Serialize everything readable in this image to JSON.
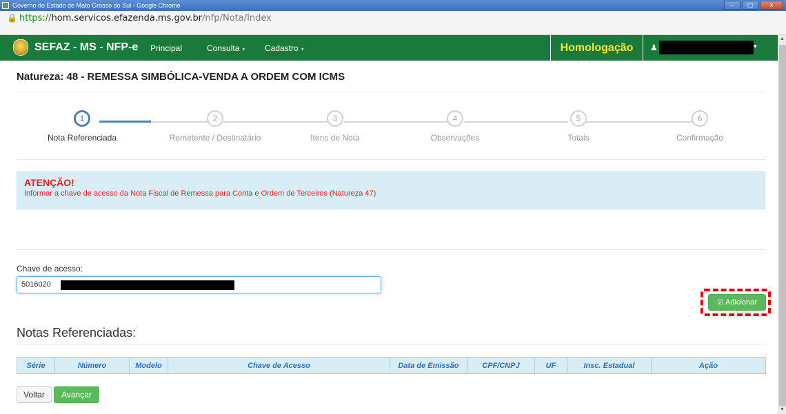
{
  "window": {
    "title": "Governo do Estado de Mato Grosso do Sul - Google Chrome",
    "controls": [
      "–",
      "▢",
      "x"
    ]
  },
  "address": {
    "scheme": "https://",
    "host": "hom.servicos.efazenda.ms.gov.br",
    "path": "/nfp/Nota/Index"
  },
  "navbar": {
    "brand": "SEFAZ - MS - NFP-e",
    "items": [
      "Principal",
      "Consulta",
      "Cadastro"
    ],
    "environment": "Homologação",
    "colors": {
      "background": "#1a7a3c",
      "environment_text": "#ffe833"
    }
  },
  "page": {
    "title": "Natureza: 48 - REMESSA SIMBÓLICA-VENDA A ORDEM COM ICMS"
  },
  "wizard": {
    "steps": [
      {
        "number": "1",
        "label": "Nota Referenciada"
      },
      {
        "number": "2",
        "label": "Remetente / Destinatário"
      },
      {
        "number": "3",
        "label": "Itens de Nota"
      },
      {
        "number": "4",
        "label": "Observações"
      },
      {
        "number": "5",
        "label": "Totais"
      },
      {
        "number": "6",
        "label": "Confirmação"
      }
    ],
    "active_step": 1
  },
  "alert": {
    "title": "ATENÇÃO!",
    "text": "Informar a chave de acesso da Nota Fiscal de Remessa para Conta e Ordem de Terceiros (Natureza 47)"
  },
  "form": {
    "key_label": "Chave de acesso:",
    "key_value": "5016020",
    "add_button": "Adicionar"
  },
  "referenced": {
    "title": "Notas Referenciadas:",
    "columns": [
      "Série",
      "Número",
      "Modelo",
      "Chave de Acesso",
      "Data de Emissão",
      "CPF/CNPJ",
      "UF",
      "Insc. Estadual",
      "Ação"
    ]
  },
  "actions": {
    "back": "Voltar",
    "next": "Avançar"
  }
}
